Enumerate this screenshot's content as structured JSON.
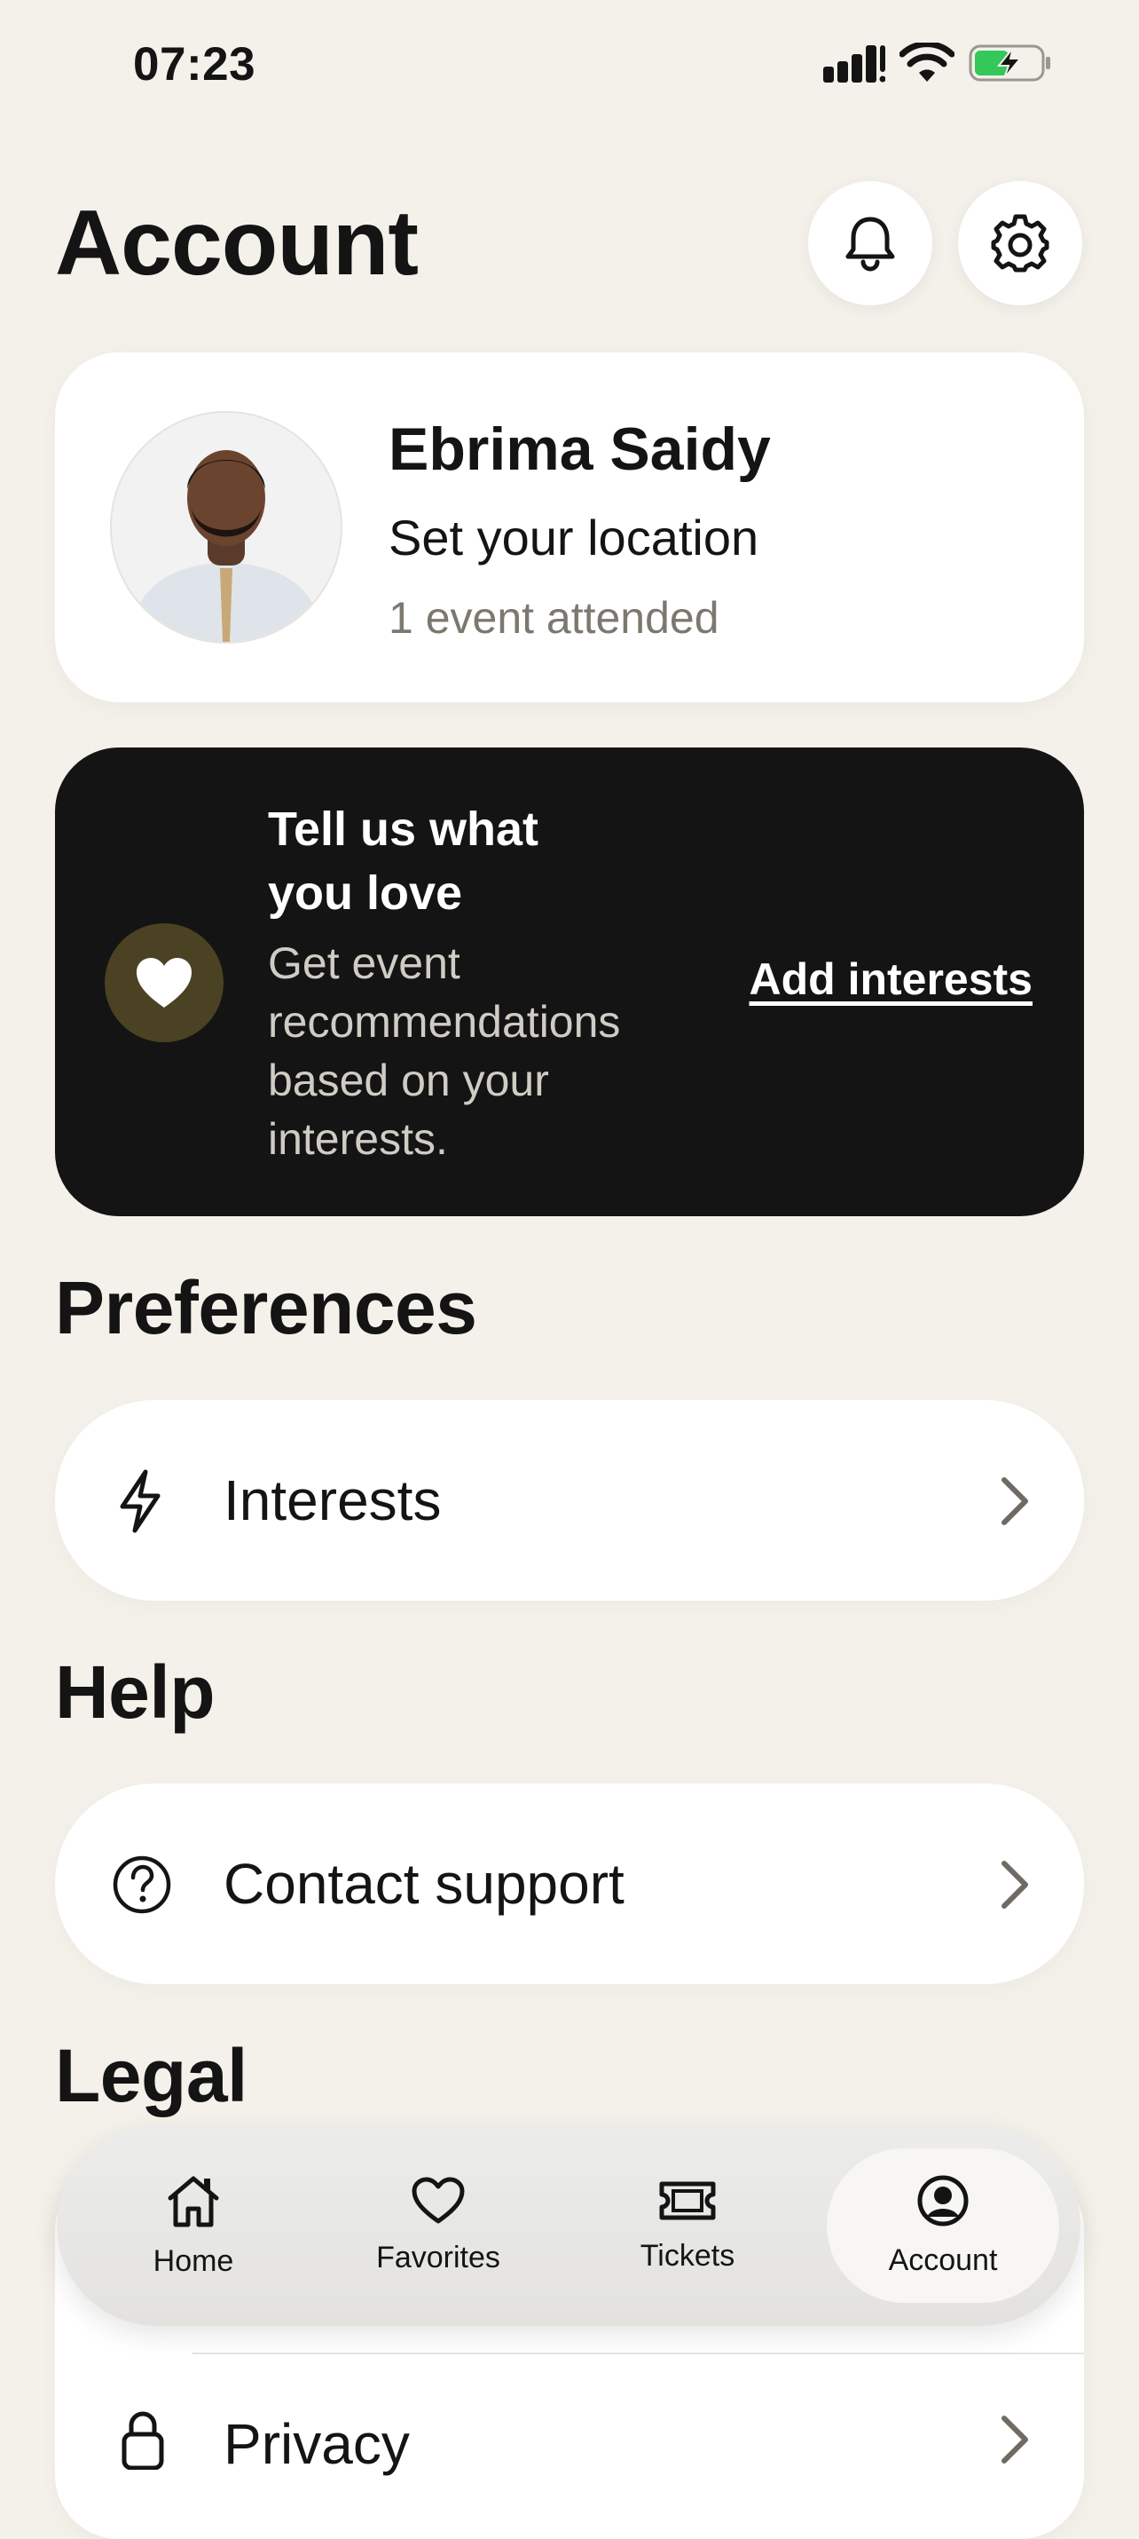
{
  "status_bar": {
    "time": "07:23"
  },
  "header": {
    "title": "Account",
    "notifications_icon": "bell-icon",
    "settings_icon": "gear-icon"
  },
  "profile": {
    "name": "Ebrima Saidy",
    "location": "Set your location",
    "events": "1 event attended"
  },
  "promo": {
    "title_line1": "Tell us what",
    "title_line2": "you love",
    "subtitle_line1": "Get event",
    "subtitle_line2": "recommendations",
    "subtitle_line3": "based on your",
    "subtitle_line4": "interests.",
    "link": "Add interests",
    "icon": "heart-icon"
  },
  "sections": {
    "preferences": {
      "title": "Preferences",
      "items": [
        {
          "label": "Interests",
          "icon": "bolt-icon"
        }
      ]
    },
    "help": {
      "title": "Help",
      "items": [
        {
          "label": "Contact support",
          "icon": "help-circle-icon"
        }
      ]
    },
    "legal": {
      "title": "Legal",
      "items": [
        {
          "label": "Privacy",
          "icon": "lock-icon"
        }
      ]
    }
  },
  "tabbar": {
    "tabs": [
      {
        "label": "Home",
        "icon": "home-icon"
      },
      {
        "label": "Favorites",
        "icon": "heart-outline-icon"
      },
      {
        "label": "Tickets",
        "icon": "ticket-icon"
      },
      {
        "label": "Account",
        "icon": "account-icon"
      }
    ],
    "active": "Account"
  },
  "colors": {
    "background": "#f3f1ea",
    "card": "#ffffff",
    "promo_bg": "#141414",
    "heart_circle": "#4a4223",
    "battery_green": "#34c759"
  }
}
